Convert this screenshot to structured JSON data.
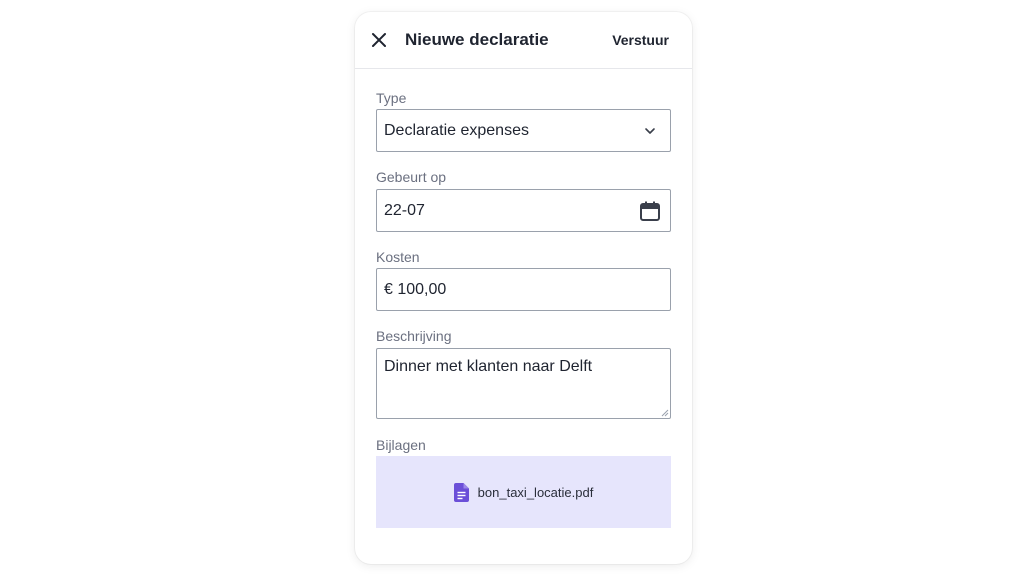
{
  "header": {
    "title": "Nieuwe declaratie",
    "send_label": "Verstuur",
    "close_icon": "close-icon"
  },
  "form": {
    "type": {
      "label": "Type",
      "value": "Declaratie expenses",
      "icon": "chevron-down-icon"
    },
    "date": {
      "label": "Gebeurt op",
      "value": "22-07",
      "icon": "calendar-icon"
    },
    "cost": {
      "label": "Kosten",
      "value": "€ 100,00"
    },
    "description": {
      "label": "Beschrijving",
      "value": "Dinner met klanten naar Delft"
    },
    "attachments": {
      "label": "Bijlagen",
      "file_name": "bon_taxi_locatie.pdf",
      "file_icon": "document-icon"
    }
  },
  "colors": {
    "attachment_bg": "#e6e5fc",
    "file_icon": "#6b4fd8",
    "border": "#9aa1ac",
    "label": "#6b7080"
  }
}
